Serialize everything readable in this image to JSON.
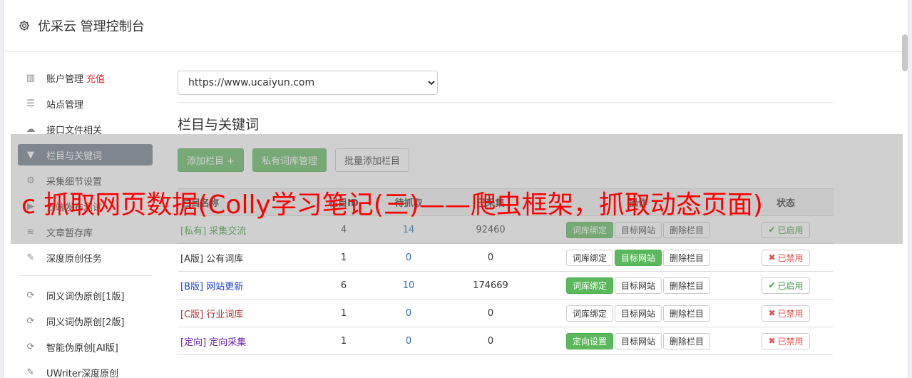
{
  "header": {
    "title": "优采云 管理控制台",
    "icon": "gear-icon"
  },
  "sidebar": {
    "items": [
      {
        "label": "账户管理",
        "extra": "充值",
        "icon": "bar-chart-icon"
      },
      {
        "label": "站点管理",
        "icon": "server-icon"
      },
      {
        "label": "接口文件相关",
        "icon": "cloud-upload-icon"
      },
      {
        "label": "栏目与关键词",
        "icon": "filter-icon",
        "active": true
      },
      {
        "label": "采集细节设置",
        "icon": "cogs-icon"
      },
      {
        "label": "云端发布测试",
        "icon": "play-circle-icon"
      },
      {
        "label": "文章暂存库",
        "icon": "database-icon"
      },
      {
        "label": "深度原创任务",
        "icon": "edit-icon"
      }
    ],
    "items2": [
      {
        "label": "同义词伪原创[1版]",
        "icon": "refresh-icon"
      },
      {
        "label": "同义词伪原创[2版]",
        "icon": "refresh-icon"
      },
      {
        "label": "智能伪原创[AI版]",
        "icon": "refresh-icon"
      },
      {
        "label": "UWriter深度原创",
        "icon": "edit-icon"
      }
    ]
  },
  "main": {
    "site_select": "https://www.ucaiyun.com",
    "section_title": "栏目与关键词",
    "buttons": {
      "add_column": "添加栏目 +",
      "private_lib": "私有词库管理",
      "batch_add": "批量添加栏目"
    },
    "table": {
      "headers": [
        "栏目名称",
        "栏目ID",
        "待抓取",
        "已采集",
        "操作",
        "状态"
      ],
      "rows": [
        {
          "tag": "[私有]",
          "name": "采集交流",
          "color": "#3c9a3c",
          "id": "4",
          "pending": "14",
          "collected": "92460",
          "op1": "词库绑定",
          "op1_green": true,
          "op2": "目标网站",
          "op2_green": false,
          "op3": "删除栏目",
          "status": "已启用",
          "status_on": true
        },
        {
          "tag": "[A版]",
          "name": "公有词库",
          "color": "#333333",
          "id": "1",
          "pending": "0",
          "collected": "0",
          "op1": "词库绑定",
          "op1_green": false,
          "op2": "目标网站",
          "op2_green": true,
          "op3": "删除栏目",
          "status": "已禁用",
          "status_on": false
        },
        {
          "tag": "[B版]",
          "name": "网站更新",
          "color": "#1a3fcf",
          "id": "6",
          "pending": "10",
          "collected": "174669",
          "op1": "词库绑定",
          "op1_green": true,
          "op2": "目标网站",
          "op2_green": false,
          "op3": "删除栏目",
          "status": "已启用",
          "status_on": true
        },
        {
          "tag": "[C版]",
          "name": "行业词库",
          "color": "#b03030",
          "id": "1",
          "pending": "0",
          "collected": "0",
          "op1": "词库绑定",
          "op1_green": false,
          "op2": "目标网站",
          "op2_green": false,
          "op3": "删除栏目",
          "status": "已禁用",
          "status_on": false
        },
        {
          "tag": "[定向]",
          "name": "定向采集",
          "color": "#6a1fa8",
          "id": "1",
          "pending": "0",
          "collected": "0",
          "op1": "定向设置",
          "op1_green": true,
          "op2": "目标网站",
          "op2_green": false,
          "op3": "删除栏目",
          "status": "已禁用",
          "status_on": false
        }
      ]
    }
  },
  "overlay": {
    "text": "c 抓取网页数据(Colly学习笔记(三)——爬虫框架，抓取动态页面)"
  }
}
